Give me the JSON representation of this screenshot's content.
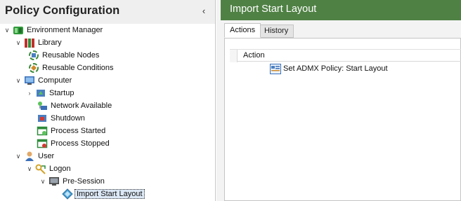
{
  "left_panel": {
    "title": "Policy Configuration",
    "collapse_glyph": "‹",
    "tree": [
      {
        "label": "Environment Manager",
        "icon": "environment-manager-icon",
        "expanded": true
      },
      {
        "label": "Library",
        "icon": "library-books-icon",
        "expanded": true
      },
      {
        "label": "Reusable Nodes",
        "icon": "reusable-nodes-icon"
      },
      {
        "label": "Reusable Conditions",
        "icon": "reusable-conditions-icon"
      },
      {
        "label": "Computer",
        "icon": "computer-monitor-icon",
        "expanded": true
      },
      {
        "label": "Startup",
        "icon": "startup-icon",
        "expanded": false
      },
      {
        "label": "Network Available",
        "icon": "network-available-icon"
      },
      {
        "label": "Shutdown",
        "icon": "shutdown-icon"
      },
      {
        "label": "Process Started",
        "icon": "process-started-icon"
      },
      {
        "label": "Process Stopped",
        "icon": "process-stopped-icon"
      },
      {
        "label": "User",
        "icon": "user-icon",
        "expanded": true
      },
      {
        "label": "Logon",
        "icon": "logon-key-icon",
        "expanded": true
      },
      {
        "label": "Pre-Session",
        "icon": "pre-session-monitor-icon",
        "expanded": true
      },
      {
        "label": "Import Start Layout",
        "icon": "import-start-layout-icon",
        "selected": true
      }
    ]
  },
  "right_panel": {
    "title": "Import Start Layout",
    "tabs": [
      {
        "label": "Actions",
        "active": true
      },
      {
        "label": "History",
        "active": false
      }
    ],
    "grid": {
      "column_header": "Action",
      "rows": [
        {
          "label": "Set ADMX Policy: Start Layout",
          "icon": "admx-policy-icon"
        }
      ]
    }
  },
  "colors": {
    "header_green": "#4f8144",
    "selection": "#dce8f5"
  }
}
